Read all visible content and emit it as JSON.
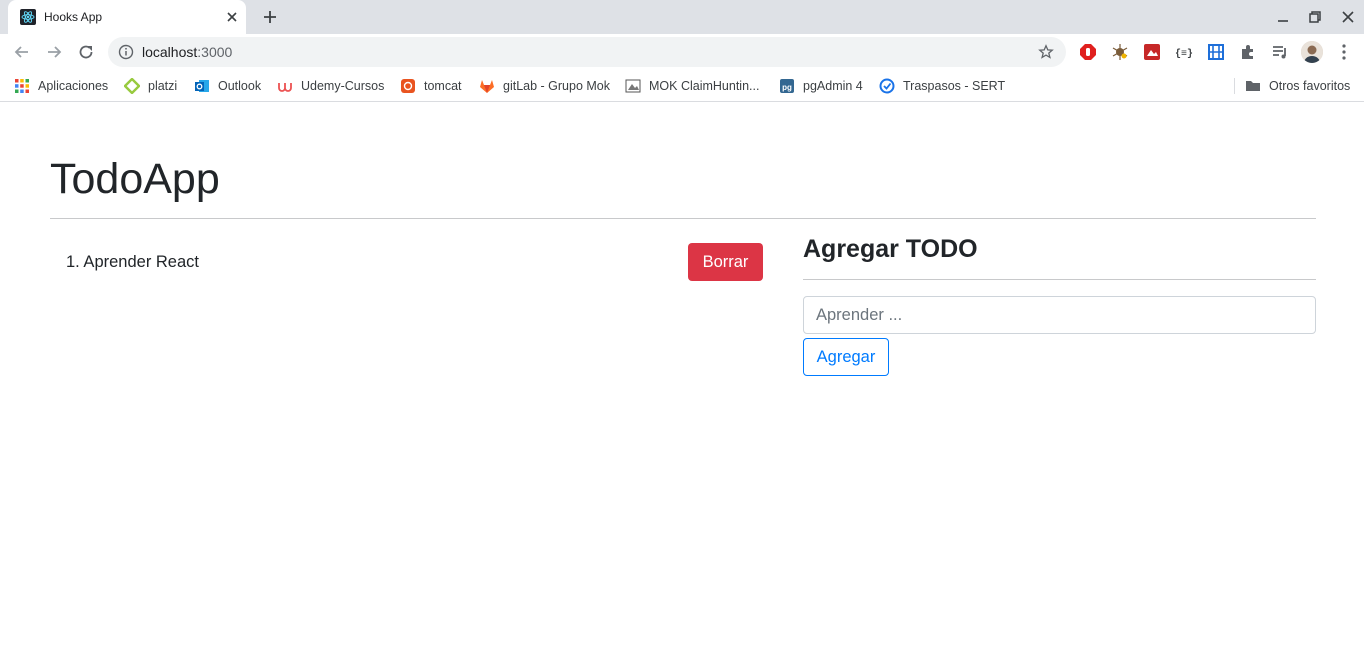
{
  "browser": {
    "tab": {
      "title": "Hooks App",
      "favicon": "react-icon"
    },
    "omnibox": {
      "host": "localhost",
      "port": ":3000"
    },
    "bookmarks": [
      {
        "label": "Aplicaciones",
        "icon": "apps-grid-icon"
      },
      {
        "label": "platzi",
        "icon": "platzi-icon"
      },
      {
        "label": "Outlook",
        "icon": "outlook-icon"
      },
      {
        "label": "Udemy-Cursos",
        "icon": "udemy-icon"
      },
      {
        "label": "tomcat",
        "icon": "tomcat-icon"
      },
      {
        "label": "gitLab - Grupo Mok",
        "icon": "gitlab-icon"
      },
      {
        "label": "MOK ClaimHuntin...",
        "icon": "mok-icon"
      },
      {
        "label": "pgAdmin 4",
        "icon": "pgadmin-icon"
      },
      {
        "label": "Traspasos - SERT",
        "icon": "sert-icon"
      }
    ],
    "other_bookmarks": "Otros favoritos"
  },
  "app": {
    "title": "TodoApp",
    "todos": [
      {
        "text": "1. Aprender React",
        "delete_label": "Borrar"
      }
    ],
    "add_form": {
      "heading": "Agregar TODO",
      "placeholder": "Aprender ...",
      "value": "",
      "submit_label": "Agregar"
    }
  },
  "colors": {
    "danger": "#dc3545",
    "primary": "#007bff",
    "text": "#212529",
    "tabstrip": "#dee1e6"
  }
}
